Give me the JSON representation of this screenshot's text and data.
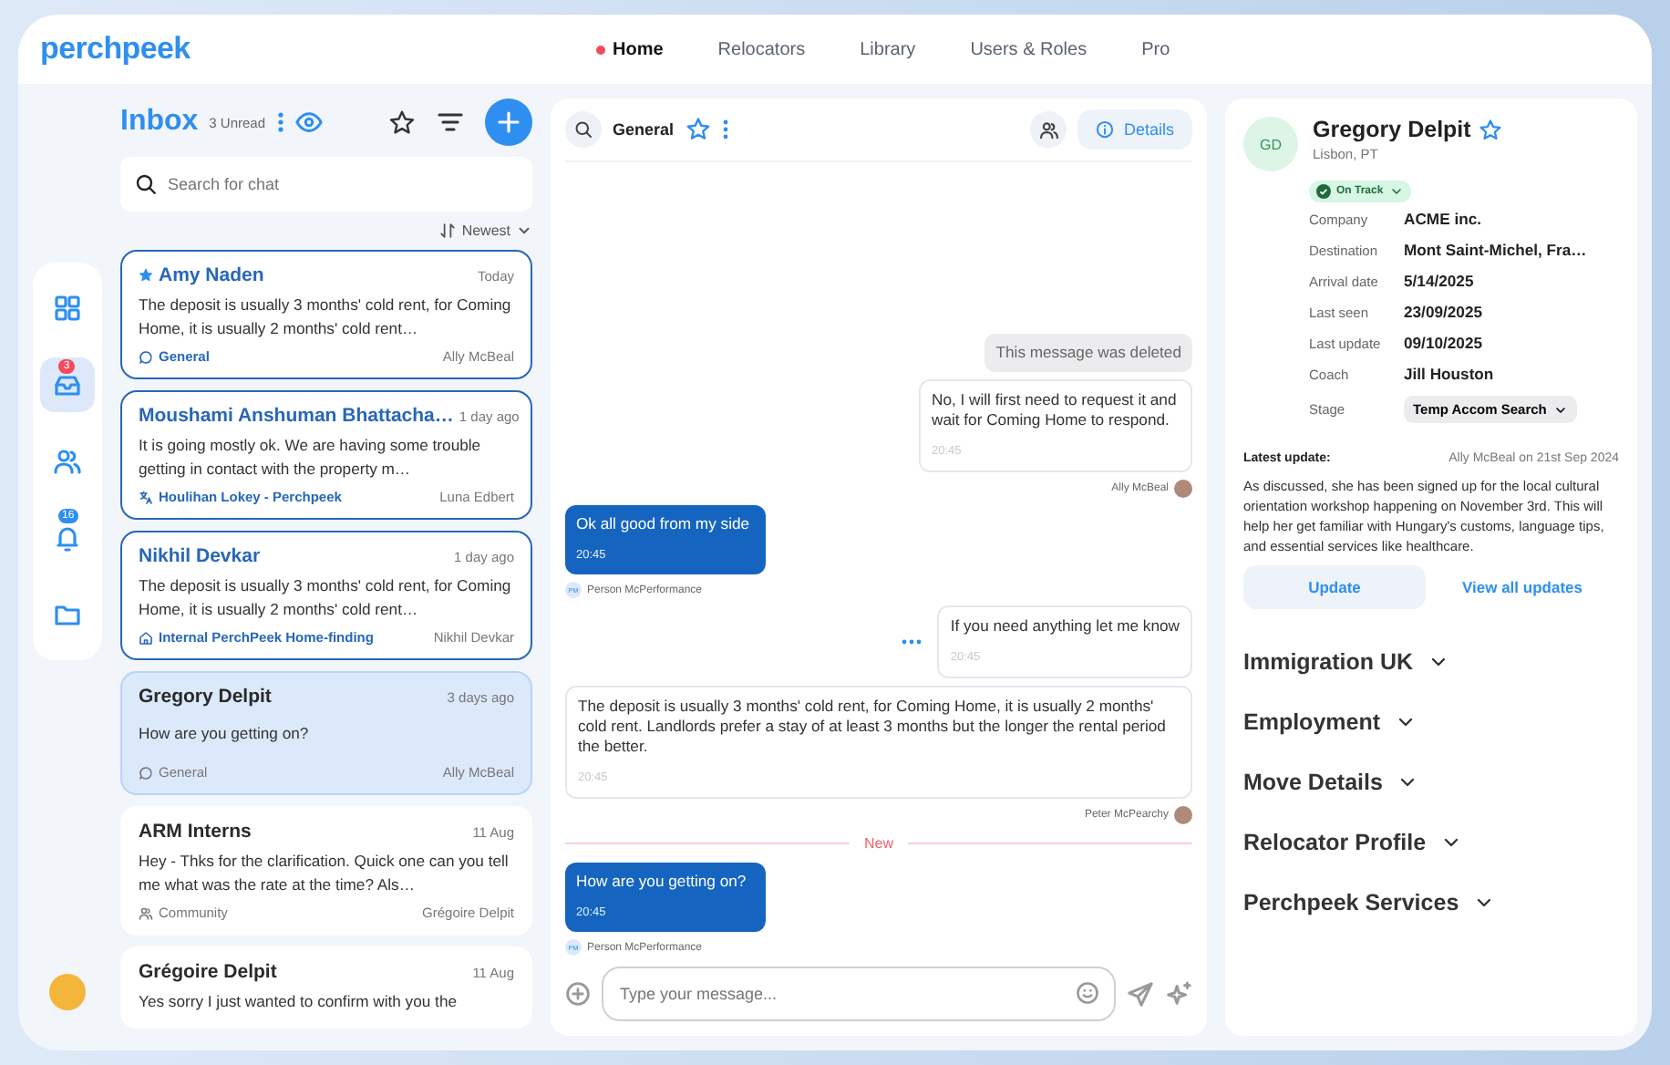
{
  "header": {
    "logo": "perchpeek",
    "nav": [
      {
        "label": "Home",
        "selected": true
      },
      {
        "label": "Relocators",
        "selected": false
      },
      {
        "label": "Library",
        "selected": false
      },
      {
        "label": "Users & Roles",
        "selected": false
      },
      {
        "label": "Pro",
        "selected": false
      }
    ]
  },
  "rail": {
    "items": [
      {
        "selected": false
      },
      {
        "selected": true,
        "badge": "3"
      },
      {
        "selected": false
      },
      {
        "selected": false,
        "badge": "16"
      },
      {
        "selected": false
      }
    ]
  },
  "inbox": {
    "title": "Inbox",
    "unread": "3 Unread",
    "search": {
      "placeholder": "Search for chat"
    },
    "sort": "Newest",
    "conversations": [
      {
        "name": "Amy Naden",
        "starred": true,
        "unread": true,
        "selected": false,
        "time": "Today",
        "preview": "The deposit is usually 3 months' cold rent, for Coming Home, it is usually 2 months' cold rent…",
        "tag": {
          "kind": "chat",
          "label": "General"
        },
        "author": "Ally McBeal"
      },
      {
        "name": "Moushami Anshuman Bhattacha…",
        "starred": false,
        "unread": true,
        "selected": false,
        "time": "1 day ago",
        "preview": "It is going mostly ok. We are having some trouble getting in contact with the property m…",
        "tag": {
          "kind": "translate",
          "label": "Houlihan Lokey - Perchpeek"
        },
        "author": "Luna Edbert"
      },
      {
        "name": "Nikhil Devkar",
        "starred": false,
        "unread": true,
        "selected": false,
        "time": "1 day ago",
        "preview": "The deposit is usually 3 months' cold rent, for Coming Home, it is usually 2 months' cold rent…",
        "tag": {
          "kind": "home",
          "label": "Internal PerchPeek Home-finding"
        },
        "author": "Nikhil Devkar"
      },
      {
        "name": "Gregory Delpit",
        "starred": false,
        "unread": false,
        "selected": true,
        "time": "3 days ago",
        "preview": "How are you getting on?",
        "tag": {
          "kind": "chat",
          "label": "General"
        },
        "author": "Ally McBeal"
      },
      {
        "name": "ARM Interns",
        "starred": false,
        "unread": false,
        "selected": false,
        "time": "11 Aug",
        "preview": "Hey - Thks for the clarification. Quick one can you tell me what was the rate at the time? Als…",
        "tag": {
          "kind": "users",
          "label": "Community"
        },
        "author": "Grégoire Delpit"
      },
      {
        "name": "Grégoire Delpit",
        "starred": false,
        "unread": false,
        "selected": false,
        "time": "11 Aug",
        "preview": "Yes sorry I just wanted to confirm with you the"
      }
    ]
  },
  "chat": {
    "channel": "General",
    "details_button": "Details",
    "composer": {
      "placeholder": "Type your message..."
    },
    "messages": [
      {
        "kind": "deleted",
        "text": "This message was deleted"
      },
      {
        "kind": "outgoing",
        "text": "No, I will first need to request it and wait for Coming Home to respond.",
        "time": "20:45",
        "author": "Ally McBeal"
      },
      {
        "kind": "incoming",
        "text": "Ok all good from my side",
        "time": "20:45",
        "author": "Person McPerformance",
        "initials": "PM"
      },
      {
        "kind": "outgoing",
        "text": "If you need anything let me know",
        "time": "20:45",
        "menu": true
      },
      {
        "kind": "outgoing_wide",
        "text": "The deposit is usually 3 months' cold rent, for Coming Home, it is usually 2 months' cold rent. Landlords prefer a stay of at least 3 months but the longer the rental period the better.",
        "time": "20:45",
        "author": "Peter McPearchy"
      },
      {
        "kind": "divider",
        "text": "New"
      },
      {
        "kind": "incoming",
        "text": "How are you getting on?",
        "time": "20:45",
        "author": "Person McPerformance",
        "initials": "PM"
      }
    ]
  },
  "profile": {
    "initials": "GD",
    "name": "Gregory Delpit",
    "starred": false,
    "location": "Lisbon, PT",
    "status": "On Track",
    "fields": [
      {
        "label": "Company",
        "value": "ACME inc."
      },
      {
        "label": "Destination",
        "value": "Mont Saint-Michel, Fra…"
      },
      {
        "label": "Arrival date",
        "value": "5/14/2025"
      },
      {
        "label": "Last seen",
        "value": "23/09/2025"
      },
      {
        "label": "Last update",
        "value": "09/10/2025"
      },
      {
        "label": "Coach",
        "value": "Jill Houston"
      },
      {
        "label": "Stage",
        "value": "Temp Accom Search",
        "kind": "dropdown"
      }
    ],
    "latest_update": {
      "label": "Latest update:",
      "byline": "Ally McBeal on 21st Sep 2024",
      "text": "As discussed, she has been signed up for the local cultural orientation workshop happening on November 3rd. This will help her get familiar with Hungary's customs, language tips, and essential services like healthcare.",
      "update_button": "Update",
      "view_all_link": "View all updates"
    },
    "sections": [
      {
        "title": "Immigration UK",
        "expanded": false
      },
      {
        "title": "Employment",
        "expanded": false
      },
      {
        "title": "Move Details",
        "expanded": false
      },
      {
        "title": "Relocator Profile",
        "expanded": false
      },
      {
        "title": "Perchpeek Services",
        "expanded": false
      }
    ]
  }
}
